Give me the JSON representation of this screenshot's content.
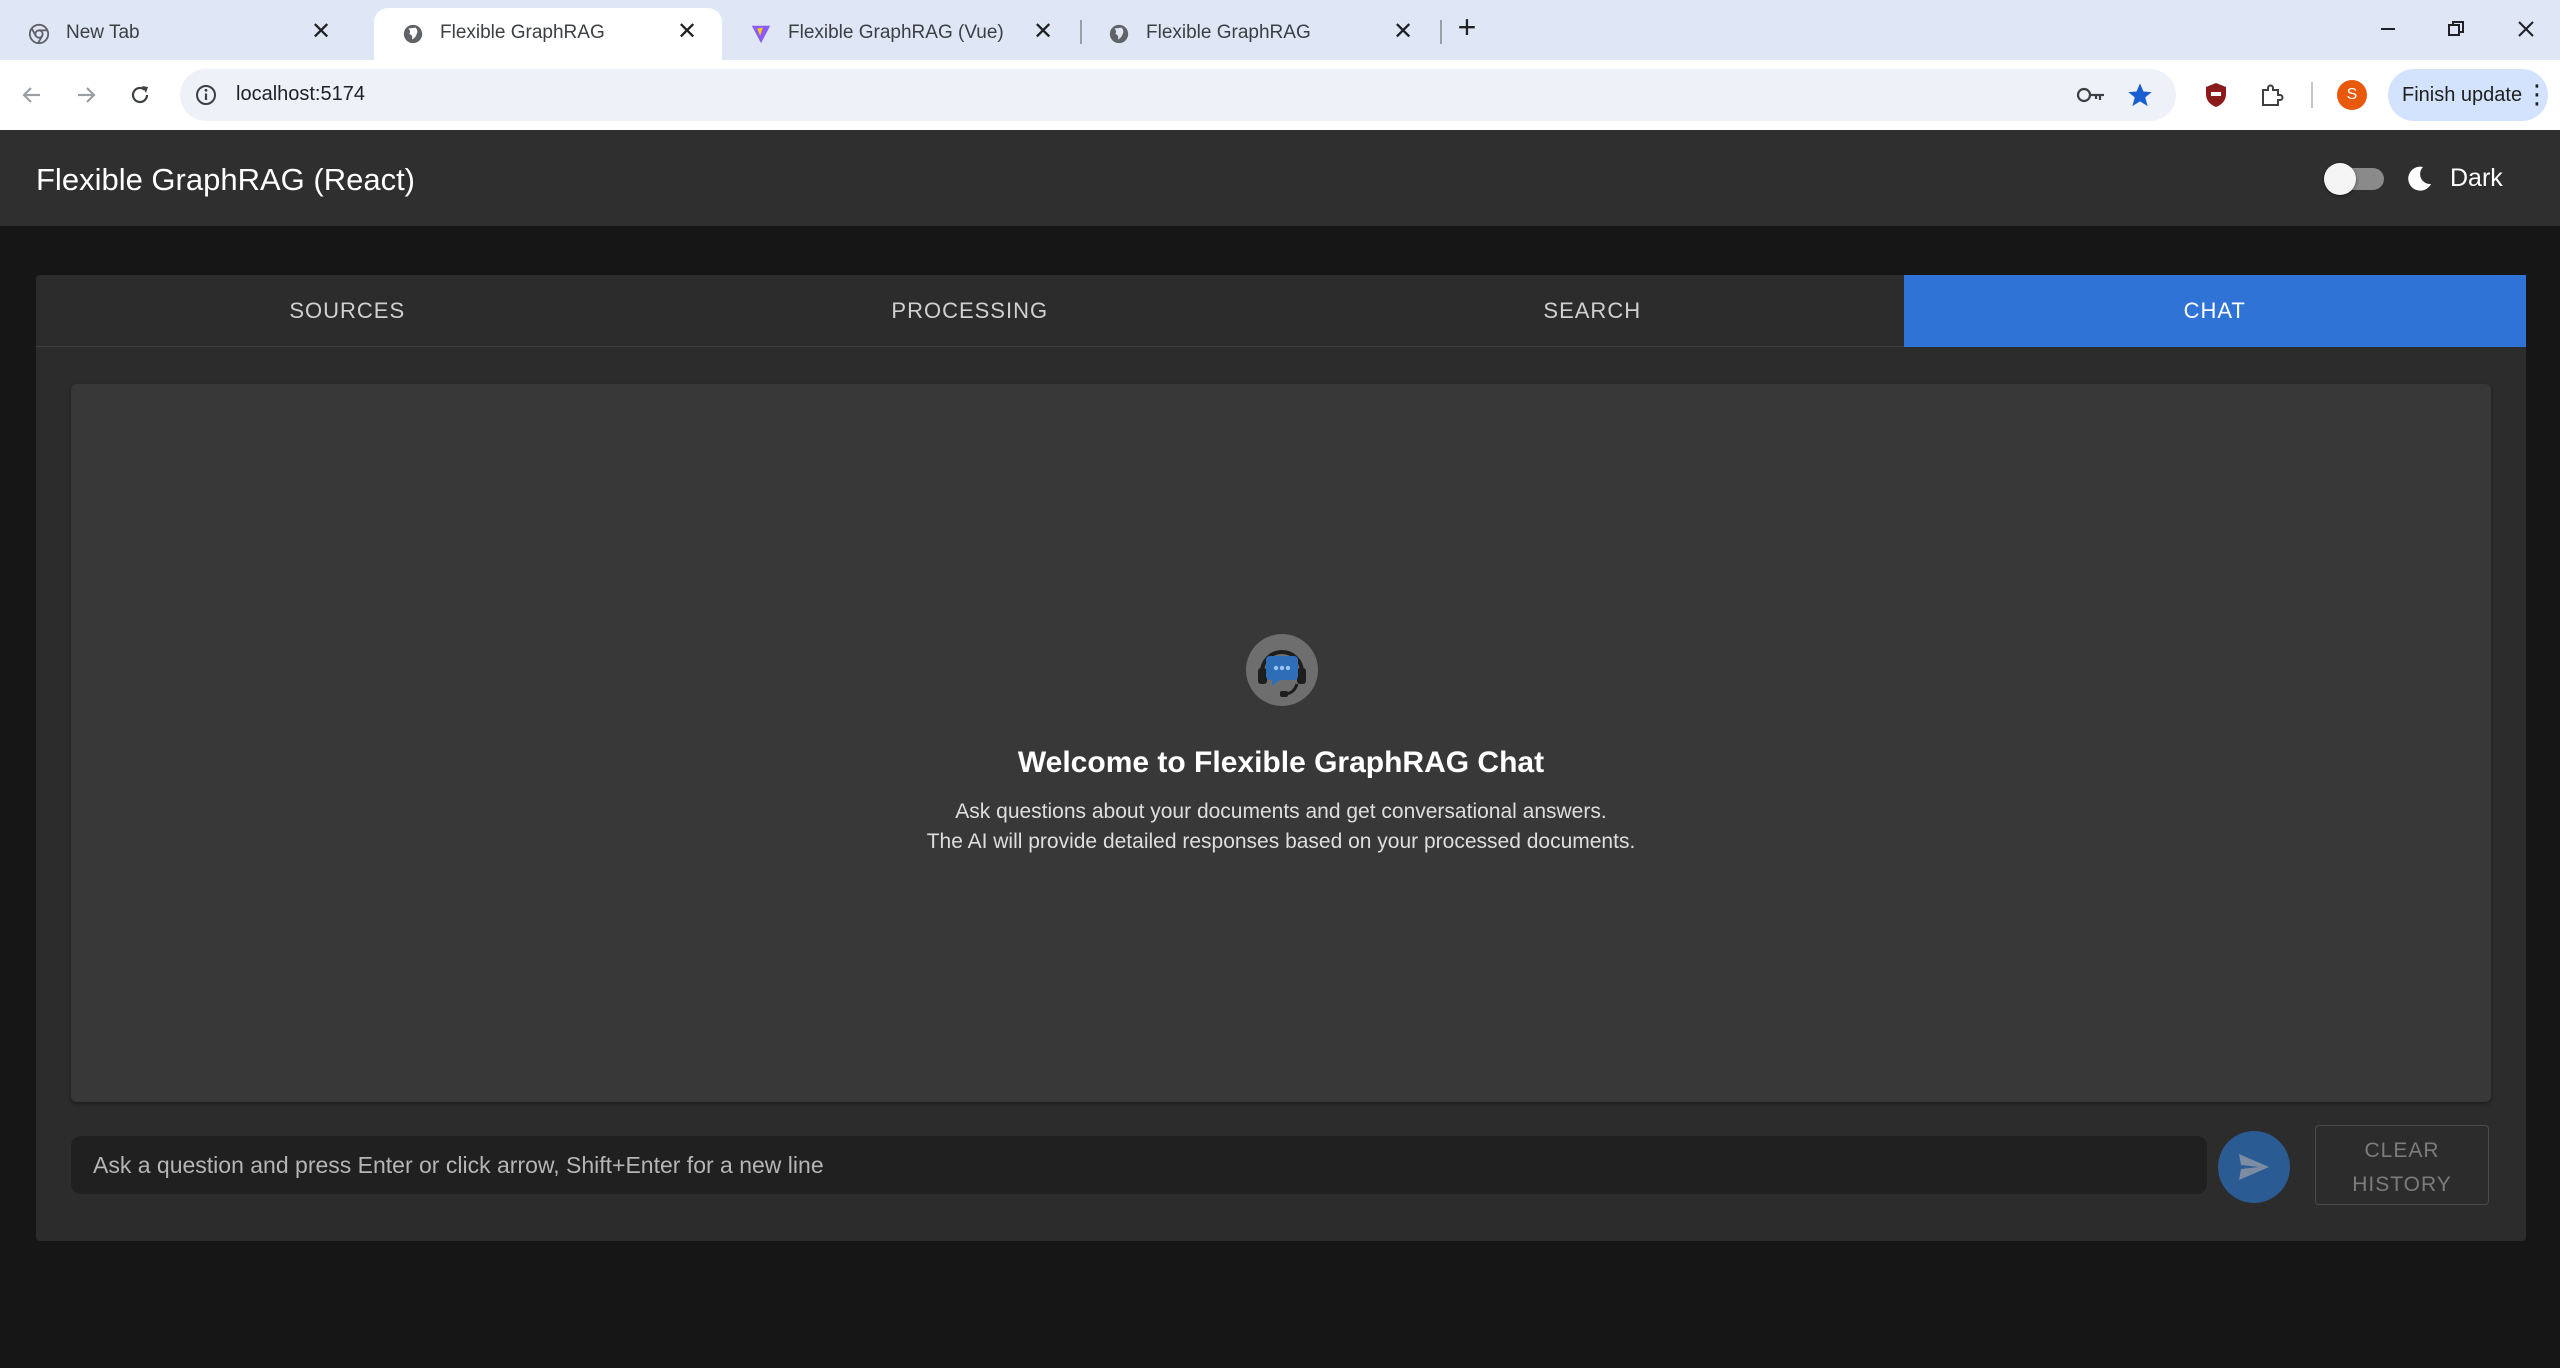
{
  "browser": {
    "tabs": [
      {
        "title": "New Tab",
        "icon": "chrome-icon",
        "active": false
      },
      {
        "title": "Flexible GraphRAG",
        "icon": "globe-icon",
        "active": true
      },
      {
        "title": "Flexible GraphRAG (Vue)",
        "icon": "vite-icon",
        "active": false
      },
      {
        "title": "Flexible GraphRAG",
        "icon": "globe-icon",
        "active": false
      }
    ],
    "close_glyph": "✕",
    "new_tab_glyph": "+",
    "url": "localhost:5174",
    "profile_initial": "S",
    "finish_update_label": "Finish update",
    "menu_glyph": "⋮"
  },
  "app": {
    "title": "Flexible GraphRAG (React)",
    "theme_label": "Dark",
    "dark_mode_toggle_on": false
  },
  "tabs": [
    {
      "label": "SOURCES",
      "selected": false
    },
    {
      "label": "PROCESSING",
      "selected": false
    },
    {
      "label": "SEARCH",
      "selected": false
    },
    {
      "label": "CHAT",
      "selected": true
    }
  ],
  "chat": {
    "welcome_title": "Welcome to Flexible GraphRAG Chat",
    "welcome_line_1": "Ask questions about your documents and get conversational answers.",
    "welcome_line_2": "The AI will provide detailed responses based on your processed documents.",
    "input_placeholder": "Ask a question and press Enter or click arrow, Shift+Enter for a new line",
    "input_value": "",
    "clear_history_line_1": "CLEAR",
    "clear_history_line_2": "HISTORY"
  },
  "colors": {
    "accent": "#2f73d6",
    "app_bg": "#161616",
    "header_bg": "#2f2f2f",
    "card_bg": "#2c2c2c",
    "chat_bg": "#383838"
  }
}
